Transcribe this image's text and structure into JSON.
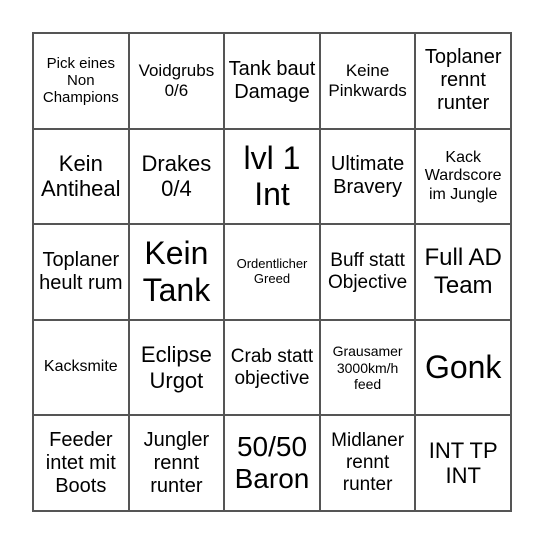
{
  "cells": [
    "Pick eines Non Champions",
    "Voidgrubs 0/6",
    "Tank baut Damage",
    "Keine Pinkwards",
    "Toplaner rennt runter",
    "Kein Antiheal",
    "Drakes 0/4",
    "lvl 1 Int",
    "Ultimate Bravery",
    "Kack Wardscore im Jungle",
    "Toplaner heult rum",
    "Kein Tank",
    "Ordentlicher Greed",
    "Buff statt Objective",
    "Full AD Team",
    "Kacksmite",
    "Eclipse Urgot",
    "Crab statt objective",
    "Grausamer 3000km/h feed",
    "Gonk",
    "Feeder intet mit Boots",
    "Jungler rennt runter",
    "50/50 Baron",
    "Midlaner rennt runter",
    "INT TP INT"
  ]
}
